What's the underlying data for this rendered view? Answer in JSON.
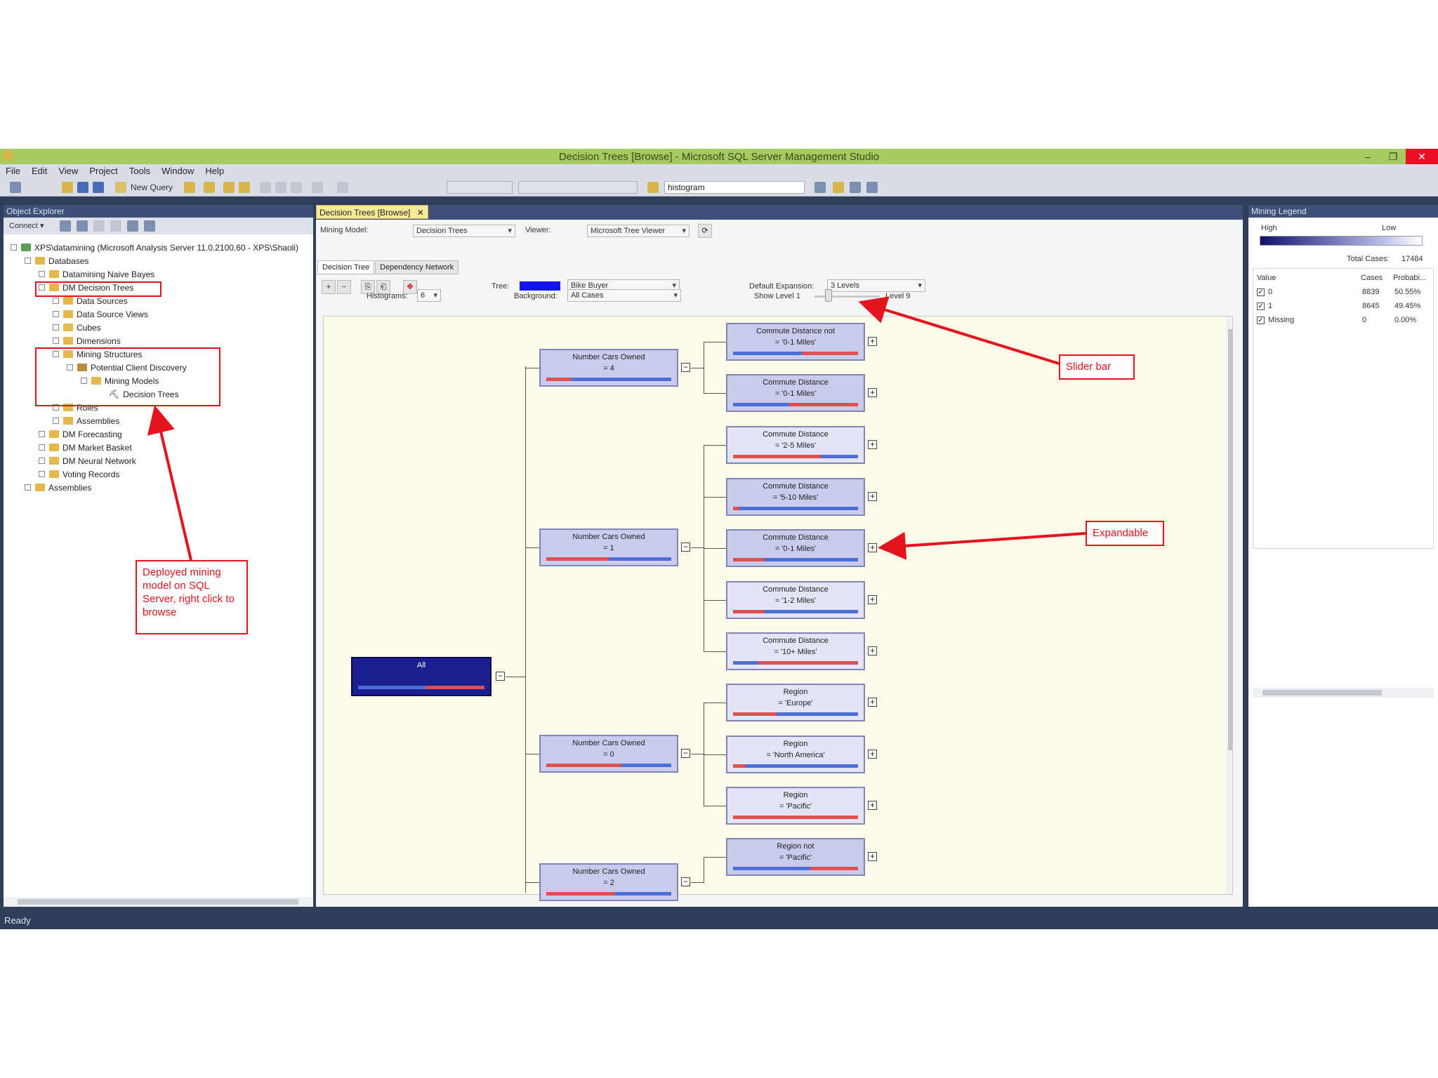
{
  "window": {
    "title": "Decision Trees [Browse] - Microsoft SQL Server Management Studio",
    "minimize": "–",
    "restore": "❐",
    "close": "✕"
  },
  "menu": [
    "File",
    "Edit",
    "View",
    "Project",
    "Tools",
    "Window",
    "Help"
  ],
  "toolbar": {
    "new_query": "New Query",
    "combo_value": "histogram"
  },
  "object_explorer": {
    "title": "Object Explorer",
    "connect": "Connect ▾",
    "server": "XPS\\datamining (Microsoft Analysis Server 11.0.2100.60 - XPS\\Shaoli)",
    "items": [
      "Databases",
      "Datamining Naive Bayes",
      "DM Decision Trees",
      "Data Sources",
      "Data Source Views",
      "Cubes",
      "Dimensions",
      "Mining Structures",
      "Potential Client Discovery",
      "Mining Models",
      "Decision Trees",
      "Roles",
      "Assemblies",
      "DM Forecasting",
      "DM Market Basket",
      "DM Neural Network",
      "Voting Records",
      "Assemblies"
    ]
  },
  "document": {
    "tab": "Decision Trees [Browse]",
    "mining_model_label": "Mining Model:",
    "mining_model_value": "Decision Trees",
    "viewer_label": "Viewer:",
    "viewer_value": "Microsoft Tree Viewer",
    "subtabs": [
      "Decision Tree",
      "Dependency Network"
    ],
    "tree_label": "Tree:",
    "tree_value": "Bike Buyer",
    "background_label": "Background:",
    "background_value": "All Cases",
    "histograms_label": "Histograms:",
    "histograms_value": "6",
    "default_expansion_label": "Default Expansion:",
    "default_expansion_value": "3 Levels",
    "show_level_label": "Show Level 1",
    "level_max_label": "Level 9",
    "tree": {
      "root": "All",
      "level1": [
        {
          "line1": "Number Cars Owned",
          "line2": "= 4"
        },
        {
          "line1": "Number Cars Owned",
          "line2": "= 1"
        },
        {
          "line1": "Number Cars Owned",
          "line2": "= 0"
        },
        {
          "line1": "Number Cars Owned",
          "line2": "= 2"
        }
      ],
      "level2": [
        {
          "line1": "Commute Distance not",
          "line2": "= '0-1 Miles'"
        },
        {
          "line1": "Commute Distance",
          "line2": "= '0-1 Miles'"
        },
        {
          "line1": "Commute Distance",
          "line2": "= '2-5 Miles'"
        },
        {
          "line1": "Commute Distance",
          "line2": "= '5-10 Miles'"
        },
        {
          "line1": "Commute Distance",
          "line2": "= '0-1 Miles'"
        },
        {
          "line1": "Commute Distance",
          "line2": "= '1-2 Miles'"
        },
        {
          "line1": "Commute Distance",
          "line2": "= '10+ Miles'"
        },
        {
          "line1": "Region",
          "line2": "= 'Europe'"
        },
        {
          "line1": "Region",
          "line2": "= 'North America'"
        },
        {
          "line1": "Region",
          "line2": "= 'Pacific'"
        },
        {
          "line1": "Region not",
          "line2": "= 'Pacific'"
        }
      ]
    }
  },
  "mining_legend": {
    "title": "Mining Legend",
    "high": "High",
    "low": "Low",
    "total_cases_label": "Total Cases:",
    "total_cases": "17484",
    "columns": [
      "Value",
      "Cases",
      "Probabi..."
    ],
    "rows": [
      {
        "value": "0",
        "cases": "8839",
        "prob": "50.55%"
      },
      {
        "value": "1",
        "cases": "8645",
        "prob": "49.45%"
      },
      {
        "value": "Missing",
        "cases": "0",
        "prob": "0.00%"
      }
    ]
  },
  "status": "Ready",
  "annotations": {
    "slider": "Slider bar",
    "expandable": "Expandable",
    "deployed": "Deployed mining model on SQL Server, right click to browse"
  },
  "colors": {
    "title_bar": "#a6c960",
    "annotation_red": "#e4141e",
    "root_node": "#1c1f8f",
    "canvas_bg": "#fdfae8"
  }
}
